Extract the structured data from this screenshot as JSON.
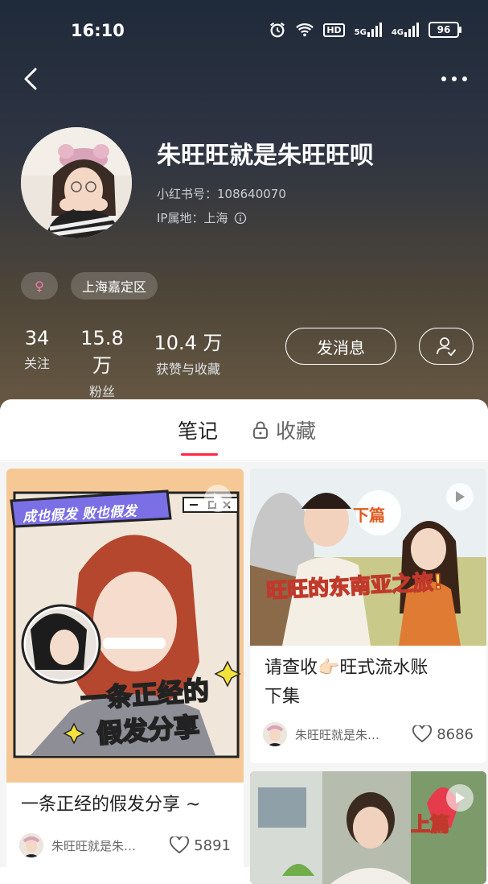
{
  "status_bar": {
    "time": "16:10",
    "hd": "HD",
    "net1": "5G",
    "net2": "4G",
    "battery": "96"
  },
  "profile": {
    "name": "朱旺旺就是朱旺旺呗",
    "id_label": "小红书号：108640070",
    "ip_label": "IP属地：上海",
    "gender_symbol": "♀",
    "gender_color": "#f27aa5",
    "location_tag": "上海嘉定区"
  },
  "stats": [
    {
      "num": "34",
      "label": "关注"
    },
    {
      "num": "15.8 万",
      "label": "粉丝"
    },
    {
      "num": "10.4 万",
      "label": "获赞与收藏"
    }
  ],
  "actions": {
    "message": "发消息",
    "follow_icon": "person-check-icon"
  },
  "tabs": {
    "notes": "笔记",
    "collect": "收藏"
  },
  "accent_color": "#ff2442",
  "cards": [
    {
      "cover_top_banner": "成也假发 败也假发",
      "cover_big_text_1": "一条正经的",
      "cover_big_text_2": "假发分享",
      "title": "一条正经的假发分享 ~",
      "author": "朱旺旺就是朱…",
      "likes": "5891"
    },
    {
      "cover_badge": "下篇",
      "cover_text": "旺旺的东南亚之旅!",
      "title_line1": "请查收👉🏻旺式流水账",
      "title_line2": "下集",
      "author": "朱旺旺就是朱…",
      "likes": "8686"
    },
    {
      "cover_badge": "上篇"
    }
  ]
}
